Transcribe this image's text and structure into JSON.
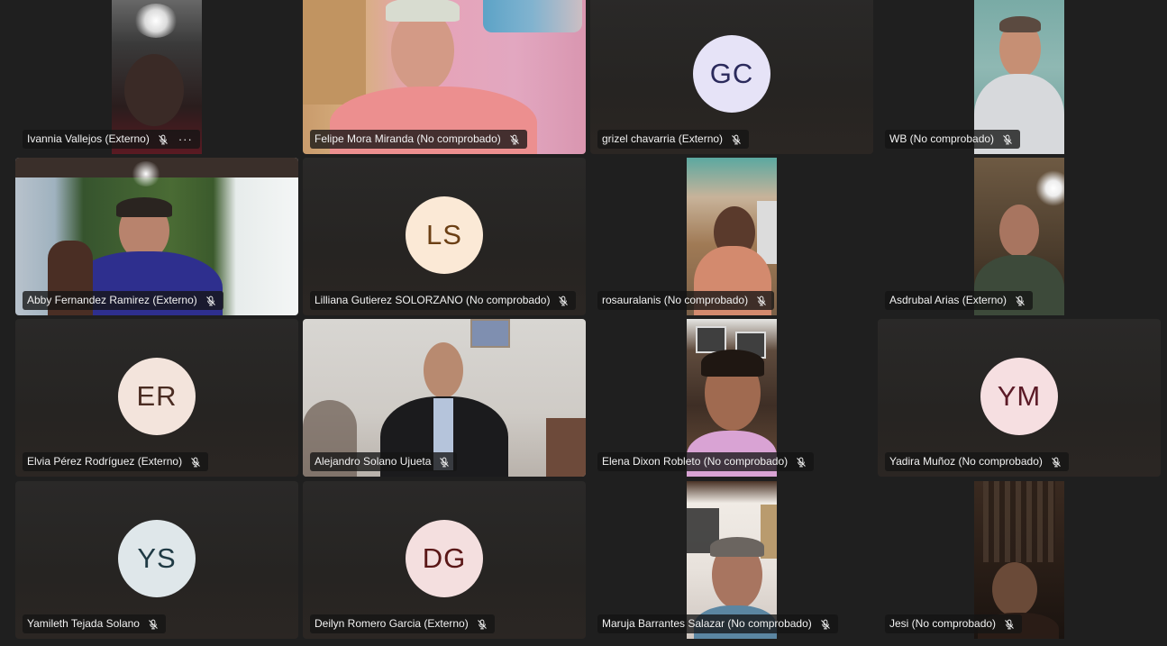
{
  "participants": [
    {
      "name": "Ivannia Vallejos (Externo)",
      "type": "video",
      "more": "···"
    },
    {
      "name": "Felipe Mora Miranda (No comprobado)",
      "type": "video"
    },
    {
      "name": "grizel chavarria (Externo)",
      "type": "avatar",
      "initials": "GC",
      "avatar_bg": "#e6e3f7",
      "avatar_fg": "#2b2a5c"
    },
    {
      "name": "WB (No comprobado)",
      "type": "video"
    },
    {
      "name": "Abby Fernandez Ramirez (Externo)",
      "type": "video"
    },
    {
      "name": "Lilliana Gutierez SOLORZANO (No comprobado)",
      "type": "avatar",
      "initials": "LS",
      "avatar_bg": "#fbe9d6",
      "avatar_fg": "#6b3f14"
    },
    {
      "name": "rosauralanis (No comprobado)",
      "type": "video"
    },
    {
      "name": "Asdrubal Arias (Externo)",
      "type": "video"
    },
    {
      "name": "Elvia Pérez Rodríguez (Externo)",
      "type": "avatar",
      "initials": "ER",
      "avatar_bg": "#f3e4dc",
      "avatar_fg": "#4a2c22"
    },
    {
      "name": "Alejandro Solano Ujueta",
      "type": "video"
    },
    {
      "name": "Elena Dixon Robleto (No comprobado)",
      "type": "video"
    },
    {
      "name": "Yadira Muñoz (No comprobado)",
      "type": "avatar",
      "initials": "YM",
      "avatar_bg": "#f6dfe1",
      "avatar_fg": "#5b1a26"
    },
    {
      "name": "Yamileth Tejada Solano",
      "type": "avatar",
      "initials": "YS",
      "avatar_bg": "#dfe7ea",
      "avatar_fg": "#1f3a44"
    },
    {
      "name": "Deilyn Romero Garcia (Externo)",
      "type": "avatar",
      "initials": "DG",
      "avatar_bg": "#f4dfdf",
      "avatar_fg": "#5a1717"
    },
    {
      "name": "Maruja Barrantes Salazar (No comprobado)",
      "type": "video"
    },
    {
      "name": "Jesi (No comprobado)",
      "type": "video"
    }
  ]
}
